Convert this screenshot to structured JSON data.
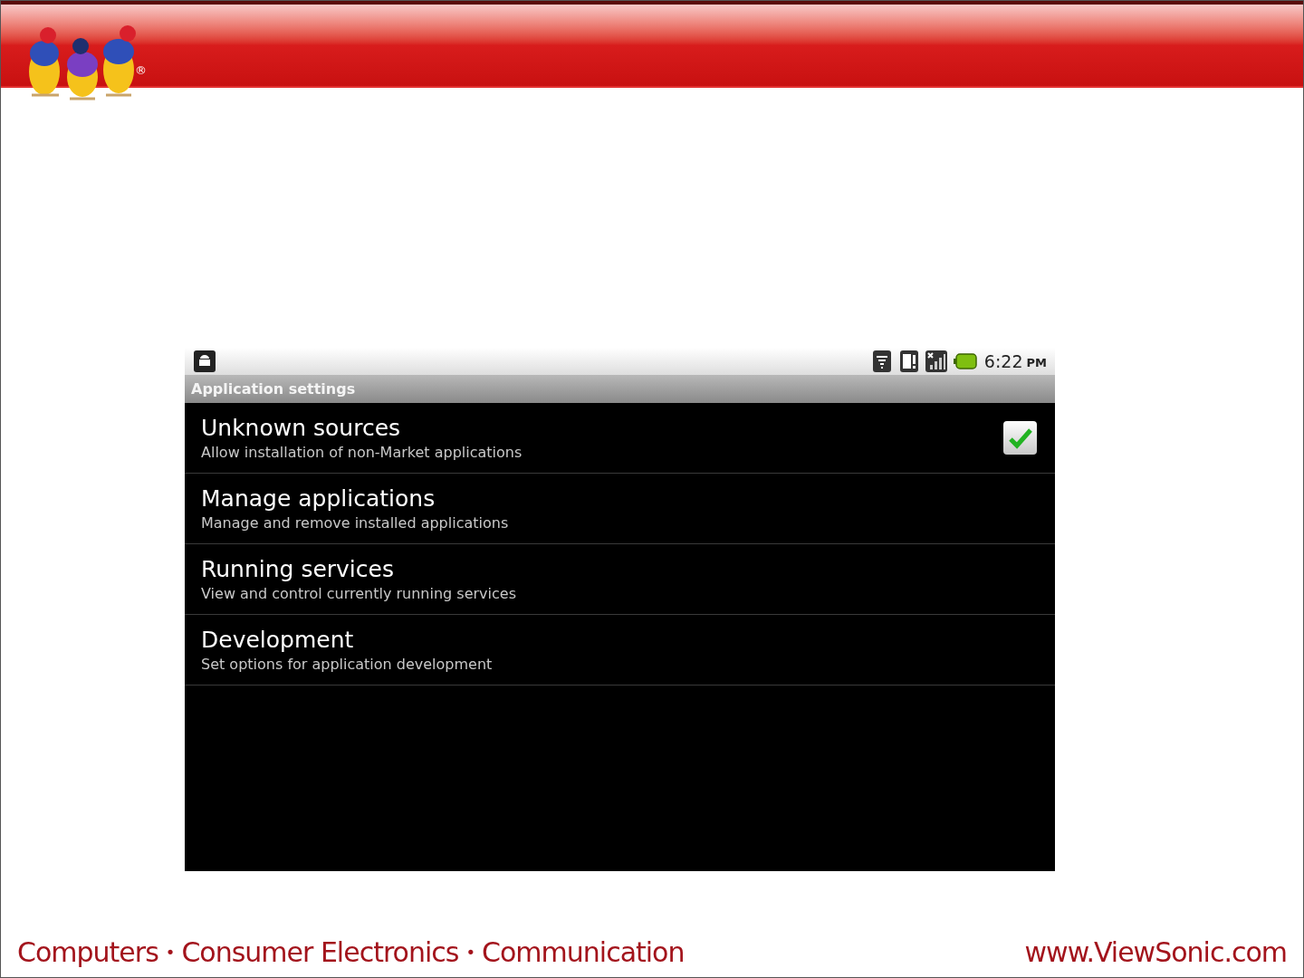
{
  "header": {
    "trademark": "®"
  },
  "device": {
    "status_bar": {
      "time": "6:22",
      "period": "PM"
    },
    "title": "Application settings",
    "items": [
      {
        "kind": "checkbox",
        "title": "Unknown sources",
        "summary": "Allow installation of non-Market applications",
        "checked": true
      },
      {
        "kind": "link",
        "title": "Manage applications",
        "summary": "Manage and remove installed applications"
      },
      {
        "kind": "link",
        "title": "Running services",
        "summary": "View and control currently running services"
      },
      {
        "kind": "link",
        "title": "Development",
        "summary": "Set options for application development"
      }
    ]
  },
  "footer": {
    "tagline": [
      "Computers",
      "Consumer Electronics",
      "Communication"
    ],
    "separator": "•",
    "url": "www.ViewSonic.com"
  }
}
